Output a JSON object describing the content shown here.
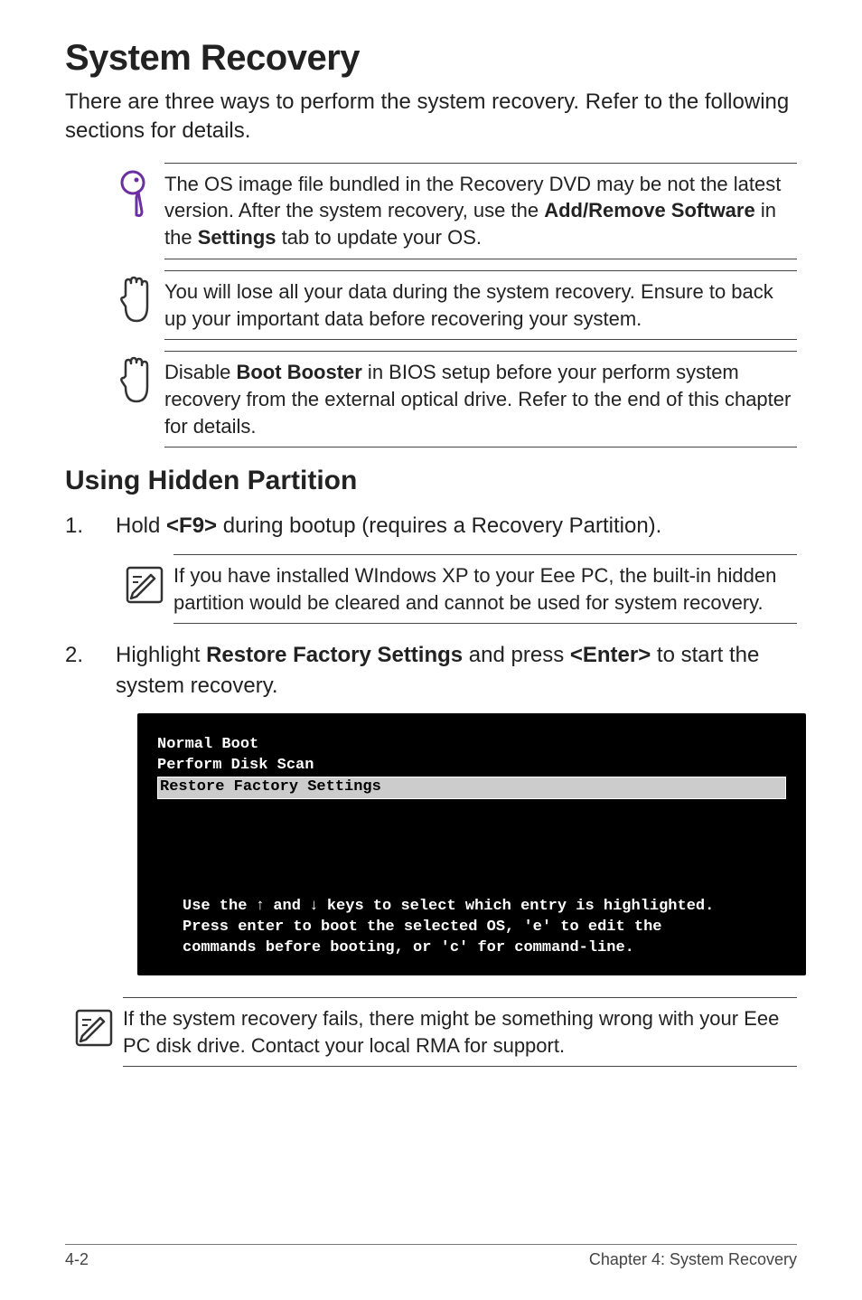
{
  "title": "System Recovery",
  "intro": "There are three ways to perform the system recovery. Refer to the following sections for details.",
  "notices": {
    "tip": {
      "segments": [
        {
          "t": "The OS image file bundled in the Recovery DVD may be not the latest version. After the system recovery, use the ",
          "b": false
        },
        {
          "t": "Add/Remove Software",
          "b": true
        },
        {
          "t": " in the ",
          "b": false
        },
        {
          "t": "Settings",
          "b": true
        },
        {
          "t": " tab to update your OS.",
          "b": false
        }
      ]
    },
    "warn1": "You will lose all your data during the system recovery. Ensure to back up your important data before recovering your system.",
    "warn2": {
      "segments": [
        {
          "t": "Disable ",
          "b": false
        },
        {
          "t": "Boot Booster",
          "b": true
        },
        {
          "t": " in BIOS setup before your perform system recovery from the external optical drive. Refer to the end of this chapter for details.",
          "b": false
        }
      ]
    }
  },
  "subheading": "Using Hidden Partition",
  "steps": [
    {
      "num": "1.",
      "segments": [
        {
          "t": "Hold ",
          "b": false
        },
        {
          "t": "<F9>",
          "b": true
        },
        {
          "t": " during bootup (requires a Recovery Partition).",
          "b": false
        }
      ]
    },
    {
      "num": "2.",
      "segments": [
        {
          "t": "Highlight ",
          "b": false
        },
        {
          "t": "Restore Factory Settings",
          "b": true
        },
        {
          "t": " and press ",
          "b": false
        },
        {
          "t": "<Enter>",
          "b": true
        },
        {
          "t": " to start the system recovery.",
          "b": false
        }
      ]
    }
  ],
  "step1_note": "If you have installed WIndows XP to your Eee PC, the built-in hidden partition would be cleared and cannot be used for system recovery.",
  "terminal": {
    "menu": [
      {
        "text": "Normal Boot",
        "hl": false
      },
      {
        "text": "Perform Disk Scan",
        "hl": false
      },
      {
        "text": "Restore Factory Settings",
        "hl": true
      }
    ],
    "hint_pre": "Use the ",
    "hint_mid": " and ",
    "hint_post": " keys to select which entry is highlighted.",
    "hint_line2": "Press enter to boot the selected OS, 'e' to edit the",
    "hint_line3": "commands before booting, or 'c' for command-line."
  },
  "final_note": "If the system recovery fails, there might be something wrong with your Eee PC disk drive. Contact your local RMA for support.",
  "footer": {
    "page": "4-2",
    "chapter": "Chapter 4: System Recovery"
  }
}
